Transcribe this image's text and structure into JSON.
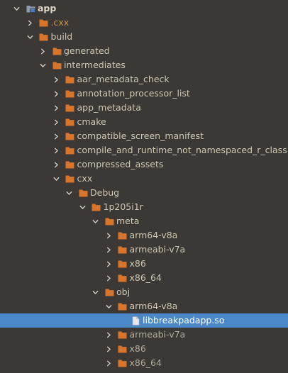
{
  "colors": {
    "background": "#3b3835",
    "selection": "#4a88c7",
    "folder_orange": "#d8752d",
    "text": "#cfc7b4",
    "excluded_text": "#c9944d"
  },
  "tree": [
    {
      "label": "app",
      "icon": "module-folder-icon",
      "expanded": true
    },
    {
      "label": ".cxx",
      "icon": "folder-icon",
      "expanded": false
    },
    {
      "label": "build",
      "icon": "folder-icon",
      "expanded": true
    },
    {
      "label": "generated",
      "icon": "folder-icon",
      "expanded": false
    },
    {
      "label": "intermediates",
      "icon": "folder-icon",
      "expanded": true
    },
    {
      "label": "aar_metadata_check",
      "icon": "folder-icon",
      "expanded": false
    },
    {
      "label": "annotation_processor_list",
      "icon": "folder-icon",
      "expanded": false
    },
    {
      "label": "app_metadata",
      "icon": "folder-icon",
      "expanded": false
    },
    {
      "label": "cmake",
      "icon": "folder-icon",
      "expanded": false
    },
    {
      "label": "compatible_screen_manifest",
      "icon": "folder-icon",
      "expanded": false
    },
    {
      "label": "compile_and_runtime_not_namespaced_r_class",
      "icon": "folder-icon",
      "expanded": false
    },
    {
      "label": "compressed_assets",
      "icon": "folder-icon",
      "expanded": false
    },
    {
      "label": "cxx",
      "icon": "folder-icon",
      "expanded": true
    },
    {
      "label": "Debug",
      "icon": "folder-icon",
      "expanded": true
    },
    {
      "label": "1p205i1r",
      "icon": "folder-icon",
      "expanded": true
    },
    {
      "label": "meta",
      "icon": "folder-icon",
      "expanded": true
    },
    {
      "label": "arm64-v8a",
      "icon": "folder-icon",
      "expanded": false
    },
    {
      "label": "armeabi-v7a",
      "icon": "folder-icon",
      "expanded": false
    },
    {
      "label": "x86",
      "icon": "folder-icon",
      "expanded": false
    },
    {
      "label": "x86_64",
      "icon": "folder-icon",
      "expanded": false
    },
    {
      "label": "obj",
      "icon": "folder-icon",
      "expanded": true
    },
    {
      "label": "arm64-v8a",
      "icon": "folder-icon",
      "expanded": true
    },
    {
      "label": "libbreakpadapp.so",
      "icon": "file-icon",
      "selected": true
    },
    {
      "label": "armeabi-v7a",
      "icon": "folder-icon",
      "expanded": false
    },
    {
      "label": "x86",
      "icon": "folder-icon",
      "expanded": false
    },
    {
      "label": "x86_64",
      "icon": "folder-icon",
      "expanded": false
    }
  ]
}
